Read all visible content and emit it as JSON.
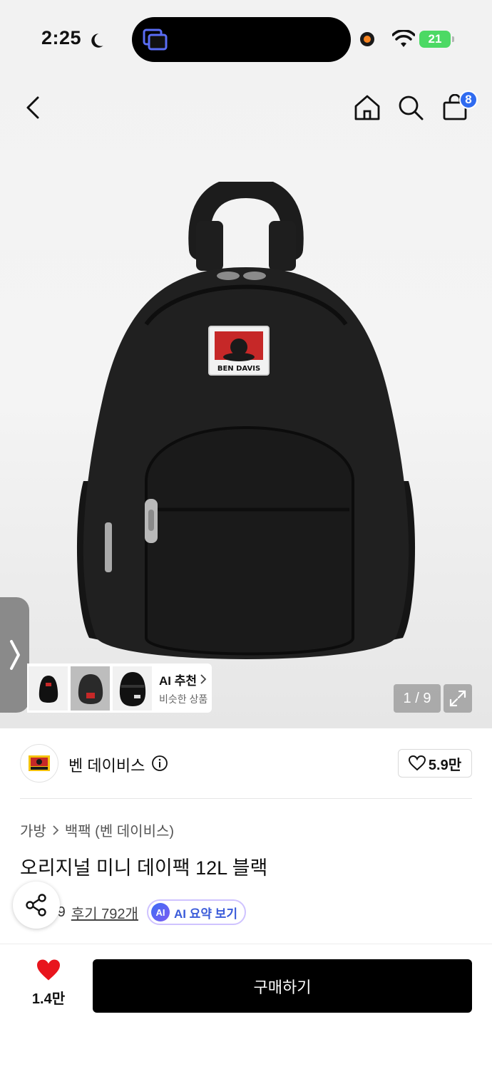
{
  "status_bar": {
    "time": "2:25",
    "battery": "21"
  },
  "header": {
    "cart_count": "8"
  },
  "gallery": {
    "counter": "1 / 9",
    "ai_recommend": {
      "title": "AI 추천",
      "subtitle": "비슷한 상품"
    }
  },
  "brand": {
    "name": "벤 데이비스",
    "likes": "5.9만",
    "logo_text": "BEN DAVIS"
  },
  "product": {
    "breadcrumb": [
      "가방",
      "백팩 (벤 데이비스)"
    ],
    "title": "오리지널 미니 데이팩 12L 블랙",
    "rating": "4.9",
    "reviews": "후기 792개",
    "ai_badge": "AI",
    "ai_summary": "AI 요약 보기"
  },
  "bottom_bar": {
    "wish_count": "1.4만",
    "buy_label": "구매하기"
  },
  "colors": {
    "accent_blue": "#2f6bf0",
    "heart_red": "#e8151d",
    "buy_black": "#000000",
    "battery_green": "#4cd964"
  }
}
